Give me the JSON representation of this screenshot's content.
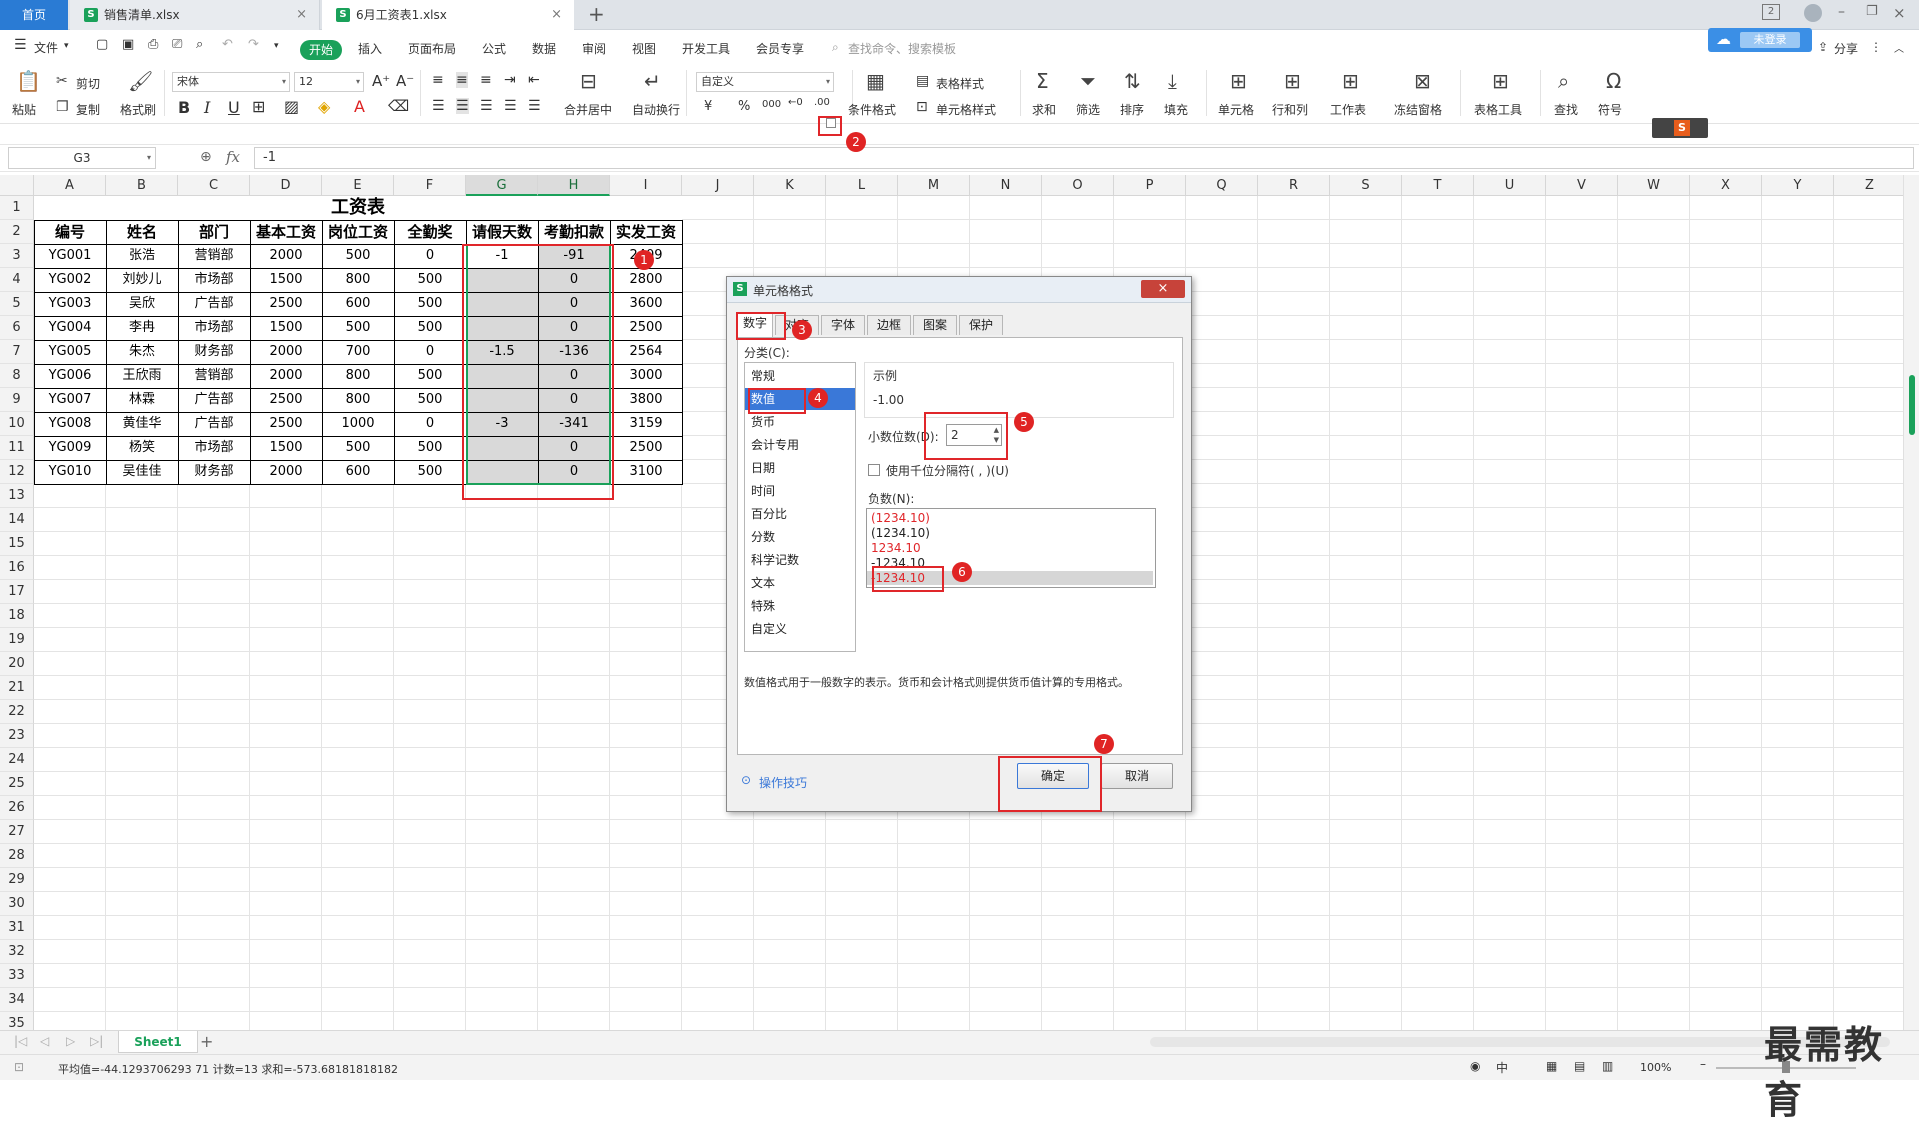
{
  "tabs": [
    {
      "label": "首页"
    },
    {
      "label": "销售清单.xlsx"
    },
    {
      "label": "6月工资表1.xlsx"
    }
  ],
  "icons": {
    "new_tab": "+",
    "close": "×",
    "sheet_s": "S"
  },
  "top_right": {
    "login": "未登录",
    "share": "分享"
  },
  "menu": {
    "file": "文件",
    "items": [
      "开始",
      "插入",
      "页面布局",
      "公式",
      "数据",
      "审阅",
      "视图",
      "开发工具",
      "会员专享"
    ],
    "search_placeholder": "查找命令、搜索模板"
  },
  "ribbon": {
    "paste": "粘贴",
    "cut": "剪切",
    "copy": "复制",
    "format_painter": "格式刷",
    "font_name": "宋体",
    "font_size": "12",
    "merge_center": "合并居中",
    "wrap": "自动换行",
    "number_format": "自定义",
    "cond_format": "条件格式",
    "table_style": "表格样式",
    "cell_style": "单元格样式",
    "sum": "求和",
    "filter": "筛选",
    "sort": "排序",
    "fill": "填充",
    "cell": "单元格",
    "rowcol": "行和列",
    "worksheet": "工作表",
    "freeze": "冻结窗格",
    "table_tools": "表格工具",
    "find": "查找",
    "symbol": "符号",
    "currency": "¥",
    "percent": "%",
    "thousands": "000",
    "bold": "B",
    "italic": "I",
    "underline": "U"
  },
  "formula_bar": {
    "name_box": "G3",
    "fx": "fx",
    "content": "-1"
  },
  "columns": [
    "A",
    "B",
    "C",
    "D",
    "E",
    "F",
    "G",
    "H",
    "I",
    "J",
    "K",
    "L",
    "M",
    "N",
    "O",
    "P",
    "Q",
    "R",
    "S",
    "T",
    "U",
    "V",
    "W",
    "X",
    "Y",
    "Z"
  ],
  "sheet": {
    "title": "工资表",
    "headers": [
      "编号",
      "姓名",
      "部门",
      "基本工资",
      "岗位工资",
      "全勤奖",
      "请假天数",
      "考勤扣款",
      "实发工资"
    ],
    "rows": [
      [
        "YG001",
        "张浩",
        "营销部",
        "2000",
        "500",
        "0",
        "-1",
        "-91",
        "2409"
      ],
      [
        "YG002",
        "刘妙儿",
        "市场部",
        "1500",
        "800",
        "500",
        "",
        "0",
        "2800"
      ],
      [
        "YG003",
        "吴欣",
        "广告部",
        "2500",
        "600",
        "500",
        "",
        "0",
        "3600"
      ],
      [
        "YG004",
        "李冉",
        "市场部",
        "1500",
        "500",
        "500",
        "",
        "0",
        "2500"
      ],
      [
        "YG005",
        "朱杰",
        "财务部",
        "2000",
        "700",
        "0",
        "-1.5",
        "-136",
        "2564"
      ],
      [
        "YG006",
        "王欣雨",
        "营销部",
        "2000",
        "800",
        "500",
        "",
        "0",
        "3000"
      ],
      [
        "YG007",
        "林霖",
        "广告部",
        "2500",
        "800",
        "500",
        "",
        "0",
        "3800"
      ],
      [
        "YG008",
        "黄佳华",
        "广告部",
        "2500",
        "1000",
        "0",
        "-3",
        "-341",
        "3159"
      ],
      [
        "YG009",
        "杨笑",
        "市场部",
        "1500",
        "500",
        "500",
        "",
        "0",
        "2500"
      ],
      [
        "YG010",
        "吴佳佳",
        "财务部",
        "2000",
        "600",
        "500",
        "",
        "0",
        "3100"
      ]
    ]
  },
  "sheet_tab": "Sheet1",
  "status": {
    "text": "平均值=-44.1293706293 71  计数=13  求和=-573.68181818182",
    "zoom": "100%"
  },
  "dialog": {
    "title": "单元格格式",
    "tabs": [
      "数字",
      "对齐",
      "字体",
      "边框",
      "图案",
      "保护"
    ],
    "category_label": "分类(C):",
    "categories": [
      "常规",
      "数值",
      "货币",
      "会计专用",
      "日期",
      "时间",
      "百分比",
      "分数",
      "科学记数",
      "文本",
      "特殊",
      "自定义"
    ],
    "sample_label": "示例",
    "sample_value": "-1.00",
    "decimal_label": "小数位数(D):",
    "decimal_value": "2",
    "thousands_label": "使用千位分隔符( , )(U)",
    "negative_label": "负数(N):",
    "negatives": [
      "(1234.10)",
      "(1234.10)",
      "1234.10",
      "-1234.10",
      "-1234.10"
    ],
    "description": "数值格式用于一般数字的表示。货币和会计格式则提供货币值计算的专用格式。",
    "tips": "操作技巧",
    "ok": "确定",
    "cancel": "取消"
  },
  "callouts": [
    "1",
    "2",
    "3",
    "4",
    "5",
    "6",
    "7"
  ],
  "watermark": "最需教育",
  "colors": {
    "accent": "#1aa15a",
    "callout": "#e0262a",
    "selection": "#3a78d8"
  }
}
